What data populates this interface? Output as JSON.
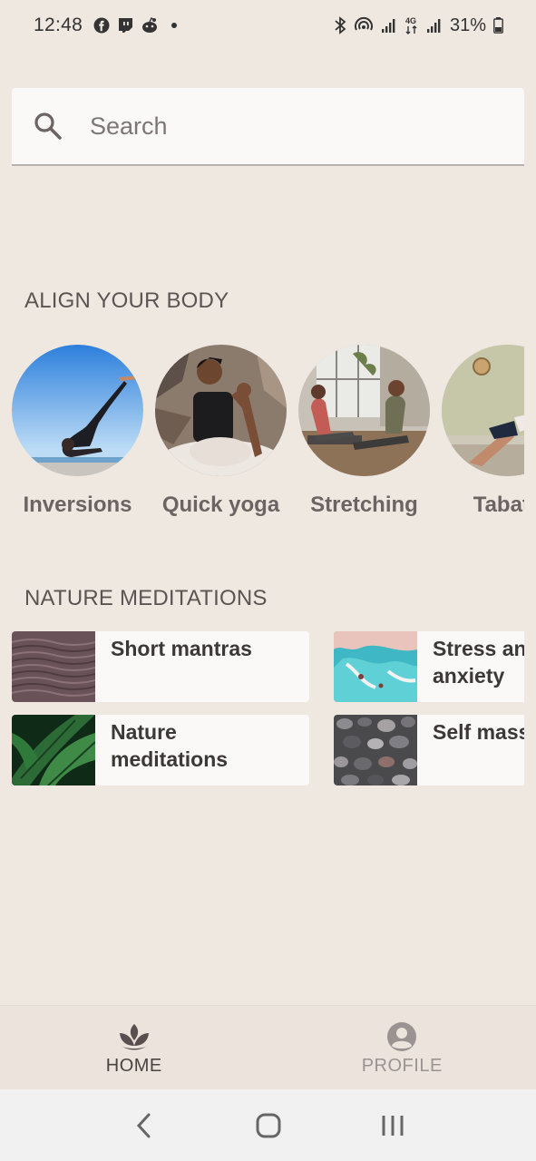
{
  "status_bar": {
    "time": "12:48",
    "battery": "31%",
    "left_icons": [
      "facebook-icon",
      "twitch-icon",
      "reddit-icon",
      "dot-icon"
    ],
    "right_icons": [
      "bluetooth-icon",
      "hotspot-icon",
      "signal-icon",
      "4g-icon",
      "signal-icon",
      "battery-icon"
    ]
  },
  "search": {
    "placeholder": "Search",
    "value": ""
  },
  "align_body": {
    "title": "ALIGN YOUR BODY",
    "items": [
      {
        "label": "Inversions"
      },
      {
        "label": "Quick yoga"
      },
      {
        "label": "Stretching"
      },
      {
        "label": "Tabata"
      }
    ]
  },
  "nature_meditations": {
    "title": "NATURE MEDITATIONS",
    "items": [
      {
        "label_line1": "Short mantras",
        "label_line2": ""
      },
      {
        "label_line1": "Stress and",
        "label_line2": "anxiety"
      },
      {
        "label_line1": "Nature",
        "label_line2": "meditations"
      },
      {
        "label_line1": "Self massage",
        "label_line2": ""
      }
    ]
  },
  "bottom_nav": {
    "home_label": "HOME",
    "profile_label": "PROFILE"
  },
  "colors": {
    "background": "#efe8e1",
    "card": "#faf9f7",
    "nav_active": "#4a4341",
    "nav_inactive": "#9a9391"
  }
}
